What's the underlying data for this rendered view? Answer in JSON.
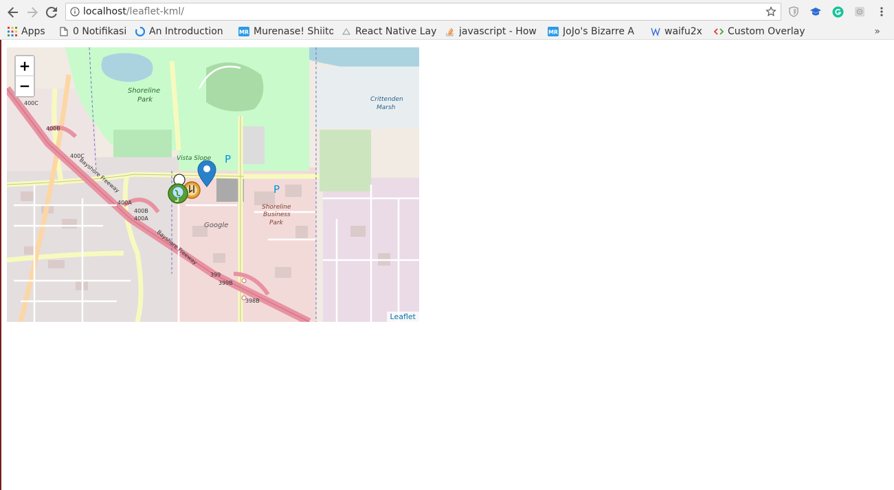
{
  "browser": {
    "url_host": "localhost",
    "url_path": "/leaflet-kml/"
  },
  "bookmarks": {
    "apps": "Apps",
    "items": [
      {
        "label": "0 Notifikasi",
        "icon": "document-icon"
      },
      {
        "label": "An Introduction",
        "icon": "leaflet-icon"
      },
      {
        "label": "Murenase! Shiito",
        "icon": "mr-icon"
      },
      {
        "label": "React Native Lay",
        "icon": "react-icon"
      },
      {
        "label": "javascript - How",
        "icon": "stackoverflow-icon"
      },
      {
        "label": "JoJo's Bizarre A",
        "icon": "mr-icon"
      },
      {
        "label": "waifu2x",
        "icon": "w-icon"
      },
      {
        "label": "Custom Overlay",
        "icon": "code-icon"
      }
    ],
    "more": "»"
  },
  "map": {
    "zoom_in": "+",
    "zoom_out": "−",
    "attribution": "Leaflet",
    "labels": {
      "shoreline_park_1": "Shoreline",
      "shoreline_park_2": "Park",
      "crittenden_1": "Crittenden",
      "crittenden_2": "Marsh",
      "vista_slope": "Vista Slope",
      "google": "Google",
      "business_1": "Shoreline",
      "business_2": "Business",
      "business_3": "Park",
      "parking": "P",
      "freeway_1": "Bayshore Freeway",
      "freeway_2": "Bayshore Freeway",
      "exit_400c": "400C",
      "exit_400b": "400B",
      "exit_400c_2": "400C",
      "exit_400a": "400A",
      "exit_400b_400a_1": "400B",
      "exit_400b_400a_2": "400A",
      "exit_399": "399",
      "exit_399b": "399B",
      "exit_398b": "398B"
    }
  },
  "colors": {
    "park": "#c8facc",
    "water": "#aad3df",
    "residential": "#e0dfdf",
    "commercial": "#f2dad9",
    "motorway": "#e892a2",
    "primary": "#fcd6a4",
    "secondary": "#f7fabf",
    "marker_blue": "#2a81cb",
    "park_text": "#2b6a2b",
    "water_text": "#2c5f8a"
  }
}
